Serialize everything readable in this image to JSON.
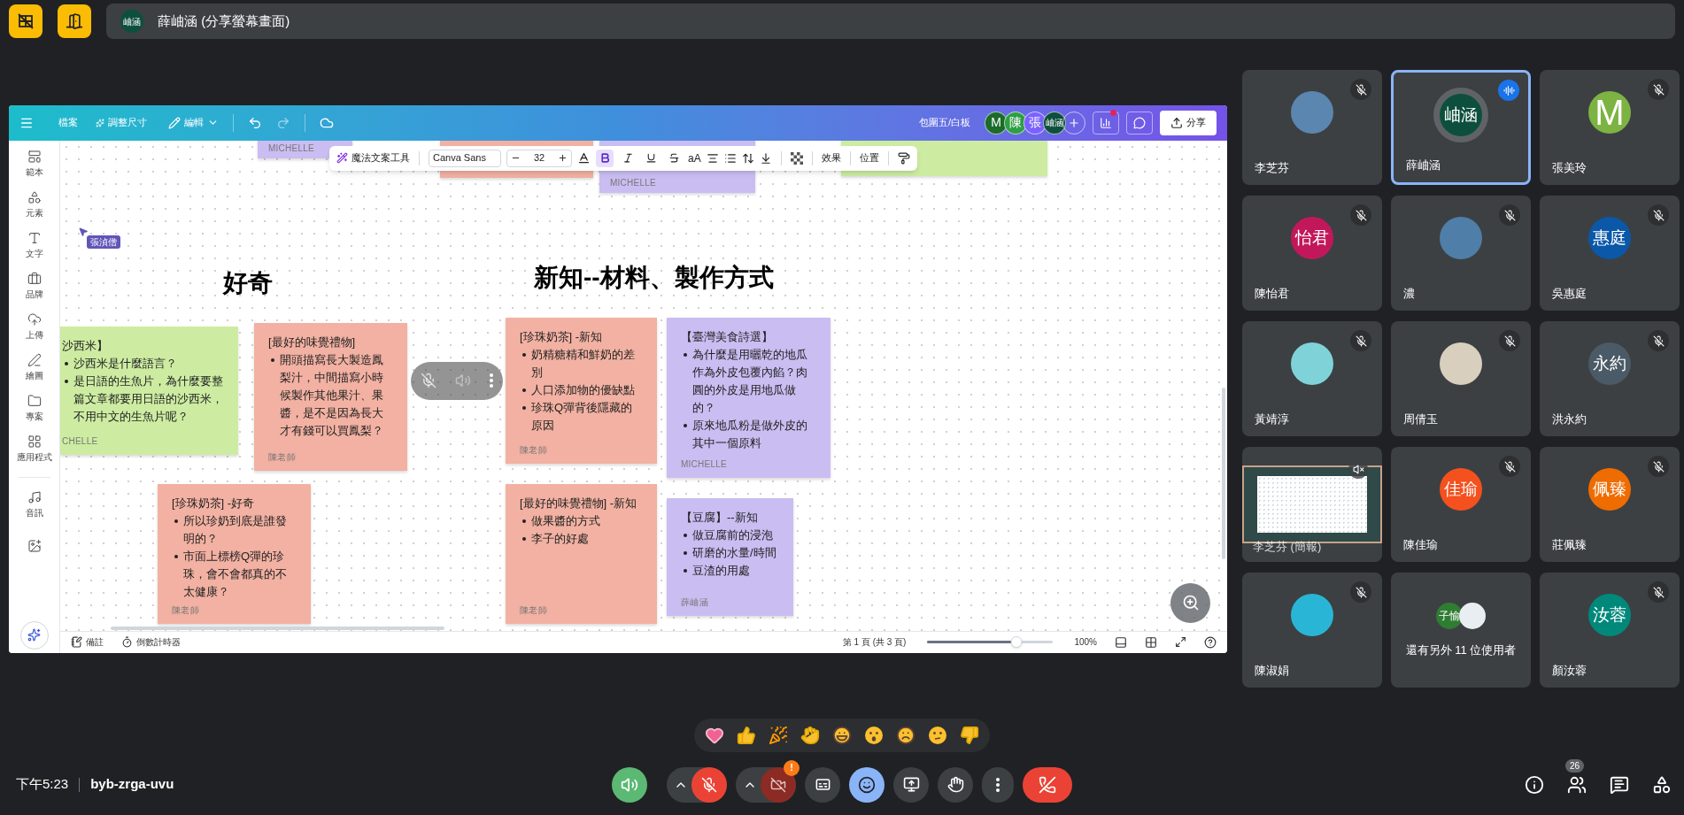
{
  "top_bar": {
    "presenter_avatar": {
      "text": "岫涵",
      "color": "#0d4f3c"
    },
    "presenter_label": "薛岫涵 (分享螢幕畫面)"
  },
  "canva": {
    "header": {
      "file": "檔案",
      "resize": "調整尺寸",
      "edit": "編輯",
      "doc_title": "包圍五/白板",
      "collaborators": [
        {
          "text": "M",
          "color": "#1b6b2a"
        },
        {
          "text": "陳",
          "color": "#2f9e44"
        },
        {
          "text": "張",
          "color": "#7b61ff"
        },
        {
          "text": "岫涵",
          "color": "#0d4f3c"
        }
      ],
      "share": "分享"
    },
    "sidebar": [
      {
        "kind": "templates",
        "label": "範本"
      },
      {
        "kind": "elements",
        "label": "元素"
      },
      {
        "kind": "text",
        "label": "文字"
      },
      {
        "kind": "brand",
        "label": "品牌"
      },
      {
        "kind": "uploads",
        "label": "上傳"
      },
      {
        "kind": "draw",
        "label": "繪圖"
      },
      {
        "kind": "projects",
        "label": "專案"
      },
      {
        "kind": "apps",
        "label": "應用程式"
      },
      {
        "kind": "audio",
        "label": "音訊"
      },
      {
        "kind": "media"
      }
    ],
    "text_toolbar": {
      "magic": "魔法文案工具",
      "font": "Canva Sans",
      "size": "32",
      "case": "aA",
      "effects": "效果",
      "position": "位置",
      "styles": [
        {
          "kind": "bold",
          "selected": true
        },
        {
          "kind": "italic",
          "selected": false
        },
        {
          "kind": "underline",
          "selected": false
        },
        {
          "kind": "strike",
          "selected": false
        }
      ]
    },
    "cursor": {
      "name": "張湞僧"
    },
    "headings": [
      "好奇",
      "新知--材料、製作方式"
    ],
    "notes": [
      {
        "color": "#c9bdf2",
        "author": "MICHELLE"
      },
      {
        "color": "#f2b1a2"
      },
      {
        "color": "#c9bdf2",
        "author": "MICHELLE"
      },
      {
        "color": "#cdeca2"
      },
      {
        "color": "#cdeca2",
        "title": "沙西米】",
        "bullets": [
          "沙西米是什麼語言？",
          "是日語的生魚片，為什麼要整篇文章都要用日語的沙西米，不用中文的生魚片呢？"
        ],
        "author": "CHELLE"
      },
      {
        "color": "#f2b1a2",
        "title": "[最好的味覺禮物]",
        "bullets": [
          "開頭描寫長大製造鳳梨汁，中間描寫小時候製作其他果汁、果醬，是不是因為長大才有錢可以買鳳梨？"
        ],
        "author": "陳老師"
      },
      {
        "color": "#f2b1a2",
        "title": "[珍珠奶茶] -好奇",
        "bullets": [
          "所以珍奶到底是誰發明的？",
          "市面上標榜Q彈的珍珠，會不會都真的不太健康？"
        ],
        "author": "陳老師"
      },
      {
        "color": "#f2b1a2",
        "title": "[珍珠奶茶] -新知",
        "bullets": [
          "奶精糖精和鮮奶的差別",
          "人口添加物的優缺點",
          "珍珠Q彈背後隱藏的原因"
        ],
        "author": "陳老師"
      },
      {
        "color": "#f2b1a2",
        "title": "[最好的味覺禮物] -新知",
        "bullets": [
          "做果醬的方式",
          "李子的好處"
        ],
        "author": "陳老師"
      },
      {
        "color": "#c9bdf2",
        "title": "【臺灣美食詩選】",
        "bullets": [
          "為什麼是用曬乾的地瓜作為外皮包覆內餡？肉圓的外皮是用地瓜做的？",
          "原來地瓜粉是做外皮的其中一個原料"
        ],
        "author": "MICHELLE"
      },
      {
        "color": "#c9bdf2",
        "title": "【豆腐】--新知",
        "bullets": [
          "做豆腐前的浸泡",
          "研磨的水量/時間",
          "豆渣的用處"
        ],
        "author": "薛岫涵"
      }
    ],
    "footer": {
      "notes": "備註",
      "timer": "倒數計時器",
      "page": "第 1 頁 (共 3 頁)",
      "zoom": {
        "level": 0.71
      },
      "zoom_label": "100%"
    }
  },
  "participants": [
    {
      "kind": "photo",
      "name": "李芝芬",
      "color": "#5b86b0",
      "muted": true,
      "speaking": false
    },
    {
      "kind": "initials",
      "name": "薛岫涵",
      "avatar": "岫涵",
      "color": "#0d4f3c",
      "muted": false,
      "speaking": true
    },
    {
      "kind": "initials",
      "name": "張美玲",
      "avatar": "M",
      "color": "#7cb342",
      "muted": true,
      "speaking": false
    },
    {
      "kind": "initials",
      "name": "陳怡君",
      "avatar": "怡君",
      "color": "#c2185b",
      "muted": true,
      "speaking": false
    },
    {
      "kind": "photo",
      "name": "濃",
      "color": "#4f7ea8",
      "muted": true,
      "speaking": false
    },
    {
      "kind": "initials",
      "name": "吳惠庭",
      "avatar": "惠庭",
      "color": "#0b57a8",
      "muted": true,
      "speaking": false
    },
    {
      "kind": "photo",
      "name": "黃靖淳",
      "color": "#7fd3d8",
      "muted": true,
      "speaking": false
    },
    {
      "kind": "photo",
      "name": "周倩玉",
      "color": "#d9cfbf",
      "muted": true,
      "speaking": false
    },
    {
      "kind": "initials",
      "name": "洪永約",
      "avatar": "永約",
      "color": "#4a5a66",
      "muted": true,
      "speaking": false
    },
    {
      "kind": "screen",
      "name": "李芝芬 (簡報)",
      "muted": true,
      "speaking": false
    },
    {
      "kind": "initials",
      "name": "陳佳瑜",
      "avatar": "佳瑜",
      "color": "#f4511e",
      "muted": true,
      "speaking": false
    },
    {
      "kind": "initials",
      "name": "莊佩臻",
      "avatar": "佩臻",
      "color": "#ef6c00",
      "muted": true,
      "speaking": false
    },
    {
      "kind": "photo",
      "name": "陳淑娟",
      "color": "#29b6d6",
      "muted": true,
      "speaking": false
    },
    {
      "kind": "others",
      "name": "還有另外 11 位使用者",
      "muted": false,
      "speaking": false,
      "avatars": [
        {
          "text": "子愉",
          "color": "#2e7d32"
        },
        {
          "color": "#e8eef2"
        }
      ]
    },
    {
      "kind": "initials",
      "name": "顏汝蓉",
      "avatar": "汝蓉",
      "color": "#00897b",
      "muted": true,
      "speaking": false
    }
  ],
  "meeting": {
    "time": "下午5:23",
    "code": "byb-zrga-uvu"
  },
  "controls": {
    "speaker_on": true,
    "mic_on": false,
    "camera_on": false,
    "camera_alert": "!",
    "reactions_open": true,
    "people_count": "26"
  }
}
